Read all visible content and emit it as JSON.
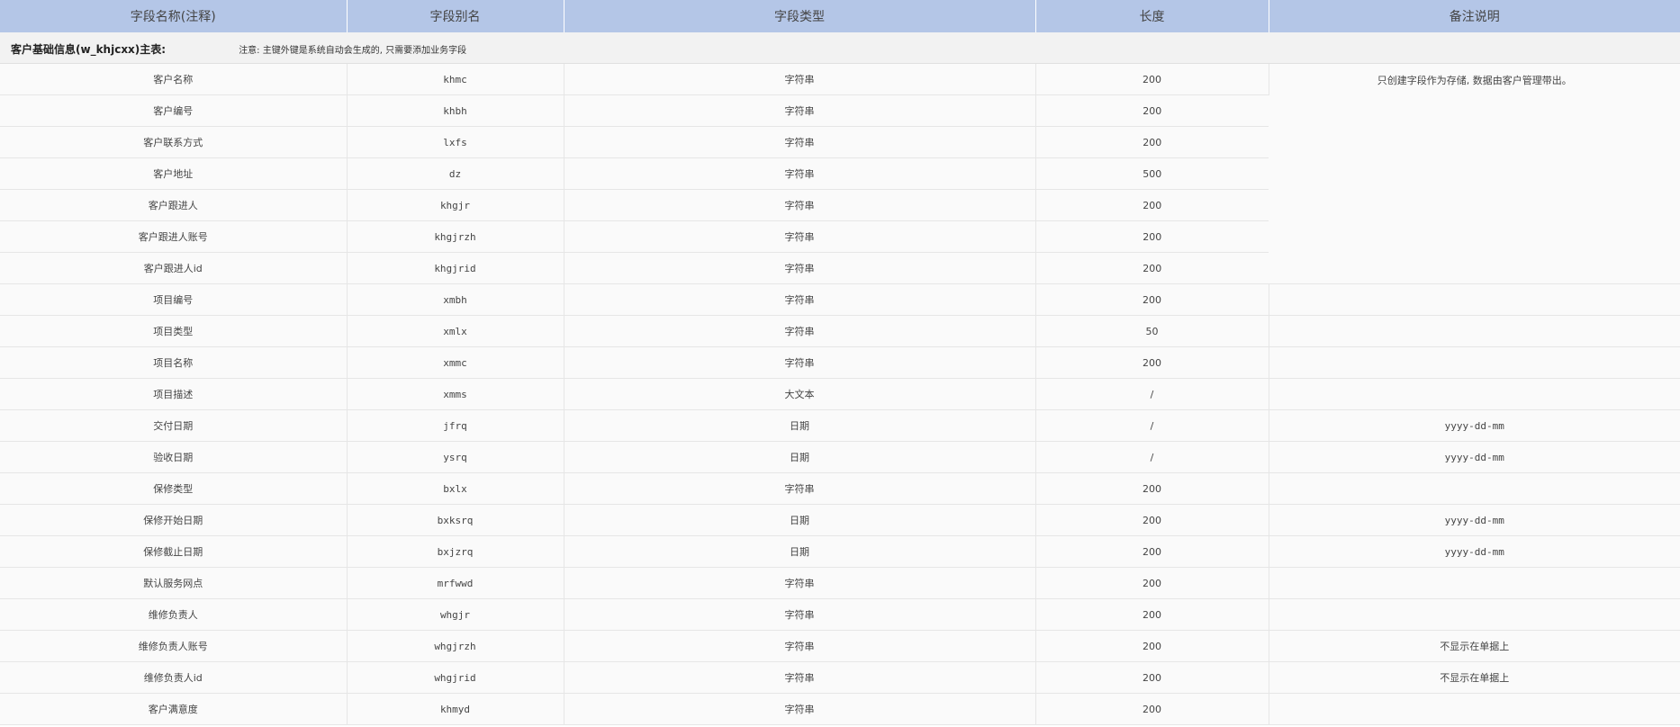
{
  "headers": [
    "字段名称(注释)",
    "字段别名",
    "字段类型",
    "长度",
    "备注说明"
  ],
  "section": {
    "title": "客户基础信息(w_khjcxx)主表:",
    "note": "注意:  主键外键是系统自动会生成的, 只需要添加业务字段"
  },
  "merged_note": "只创建字段作为存储, 数据由客户管理带出。",
  "rows": [
    {
      "name": "客户名称",
      "alias": "khmc",
      "type": "字符串",
      "length": "200",
      "note": ""
    },
    {
      "name": "客户编号",
      "alias": "khbh",
      "type": "字符串",
      "length": "200",
      "note": ""
    },
    {
      "name": "客户联系方式",
      "alias": "lxfs",
      "type": "字符串",
      "length": "200",
      "note": ""
    },
    {
      "name": "客户地址",
      "alias": "dz",
      "type": "字符串",
      "length": "500",
      "note": ""
    },
    {
      "name": "客户跟进人",
      "alias": "khgjr",
      "type": "字符串",
      "length": "200",
      "note": ""
    },
    {
      "name": "客户跟进人账号",
      "alias": "khgjrzh",
      "type": "字符串",
      "length": "200",
      "note": ""
    },
    {
      "name": "客户跟进人id",
      "alias": "khgjrid",
      "type": "字符串",
      "length": "200",
      "note": ""
    },
    {
      "name": "项目编号",
      "alias": "xmbh",
      "type": "字符串",
      "length": "200",
      "note": ""
    },
    {
      "name": "项目类型",
      "alias": "xmlx",
      "type": "字符串",
      "length": "50",
      "note": ""
    },
    {
      "name": "项目名称",
      "alias": "xmmc",
      "type": "字符串",
      "length": "200",
      "note": ""
    },
    {
      "name": "项目描述",
      "alias": "xmms",
      "type": "大文本",
      "length": "/",
      "note": ""
    },
    {
      "name": "交付日期",
      "alias": "jfrq",
      "type": "日期",
      "length": "/",
      "note": "yyyy-dd-mm"
    },
    {
      "name": "验收日期",
      "alias": "ysrq",
      "type": "日期",
      "length": "/",
      "note": "yyyy-dd-mm"
    },
    {
      "name": "保修类型",
      "alias": "bxlx",
      "type": "字符串",
      "length": "200",
      "note": ""
    },
    {
      "name": "保修开始日期",
      "alias": "bxksrq",
      "type": "日期",
      "length": "200",
      "note": "yyyy-dd-mm"
    },
    {
      "name": "保修截止日期",
      "alias": "bxjzrq",
      "type": "日期",
      "length": "200",
      "note": "yyyy-dd-mm"
    },
    {
      "name": "默认服务网点",
      "alias": "mrfwwd",
      "type": "字符串",
      "length": "200",
      "note": ""
    },
    {
      "name": "维修负责人",
      "alias": "whgjr",
      "type": "字符串",
      "length": "200",
      "note": ""
    },
    {
      "name": "维修负责人账号",
      "alias": "whgjrzh",
      "type": "字符串",
      "length": "200",
      "note": "不显示在单据上"
    },
    {
      "name": "维修负责人id",
      "alias": "whgjrid",
      "type": "字符串",
      "length": "200",
      "note": "不显示在单据上"
    },
    {
      "name": "客户满意度",
      "alias": "khmyd",
      "type": "字符串",
      "length": "200",
      "note": ""
    }
  ]
}
